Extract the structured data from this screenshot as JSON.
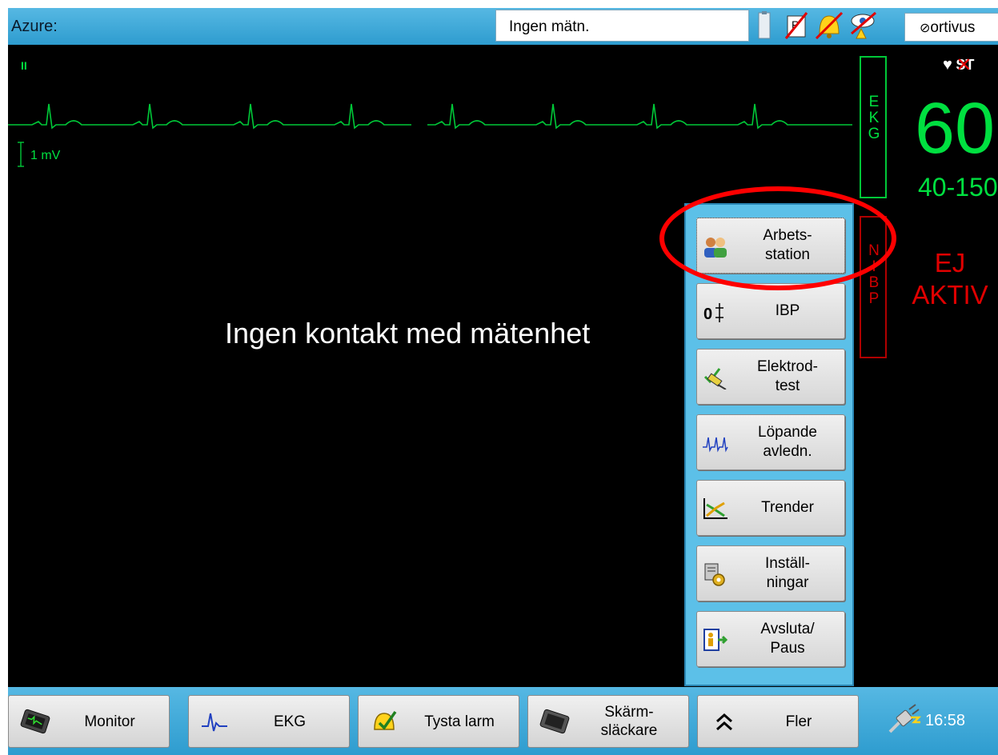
{
  "topbar": {
    "title": "Azure:",
    "status": "Ingen mätn.",
    "brand": "ortivus",
    "indicator_icons": [
      "device-icon",
      "printer-crossed-icon",
      "alarm-crossed-icon",
      "eye-crossed-icon"
    ]
  },
  "monitor": {
    "lead_label": "II",
    "scale_label": "1 mV",
    "message": "Ingen kontakt med mätenhet",
    "ekg_label": [
      "E",
      "K",
      "G"
    ],
    "nibp_label": [
      "N",
      "I",
      "B",
      "P"
    ],
    "heart_rate": "60",
    "hr_limits": "40-150",
    "nibp_status": "EJ AKTIV",
    "st_label": "ST",
    "ecg_color": "#00e040",
    "alarm_color": "#e00000"
  },
  "menu": {
    "items": [
      {
        "label": "Arbets-\nstation",
        "icon": "workstation-users-icon",
        "selected": true
      },
      {
        "label": "IBP",
        "icon": "ibp-icon"
      },
      {
        "label": "Elektrod-\ntest",
        "icon": "electrode-test-icon"
      },
      {
        "label": "Löpande\navledn.",
        "icon": "running-leads-icon"
      },
      {
        "label": "Trender",
        "icon": "trends-icon"
      },
      {
        "label": "Inställ-\nningar",
        "icon": "settings-icon"
      },
      {
        "label": "Avsluta/\nPaus",
        "icon": "exit-pause-icon"
      }
    ]
  },
  "bottombar": {
    "buttons": [
      {
        "label": "Monitor",
        "icon": "monitor-icon"
      },
      {
        "label": "EKG",
        "icon": "ekg-icon"
      },
      {
        "label": "Tysta larm",
        "icon": "silence-alarm-icon"
      },
      {
        "label": "Skärm-\nsläckare",
        "icon": "screensaver-icon"
      },
      {
        "label": "Fler",
        "icon": "chevron-up-icon"
      }
    ],
    "time": "16:58"
  },
  "colors": {
    "bar": "#3aa8d8",
    "menu_bg": "#5cc0e8",
    "highlight": "#ff0000"
  }
}
